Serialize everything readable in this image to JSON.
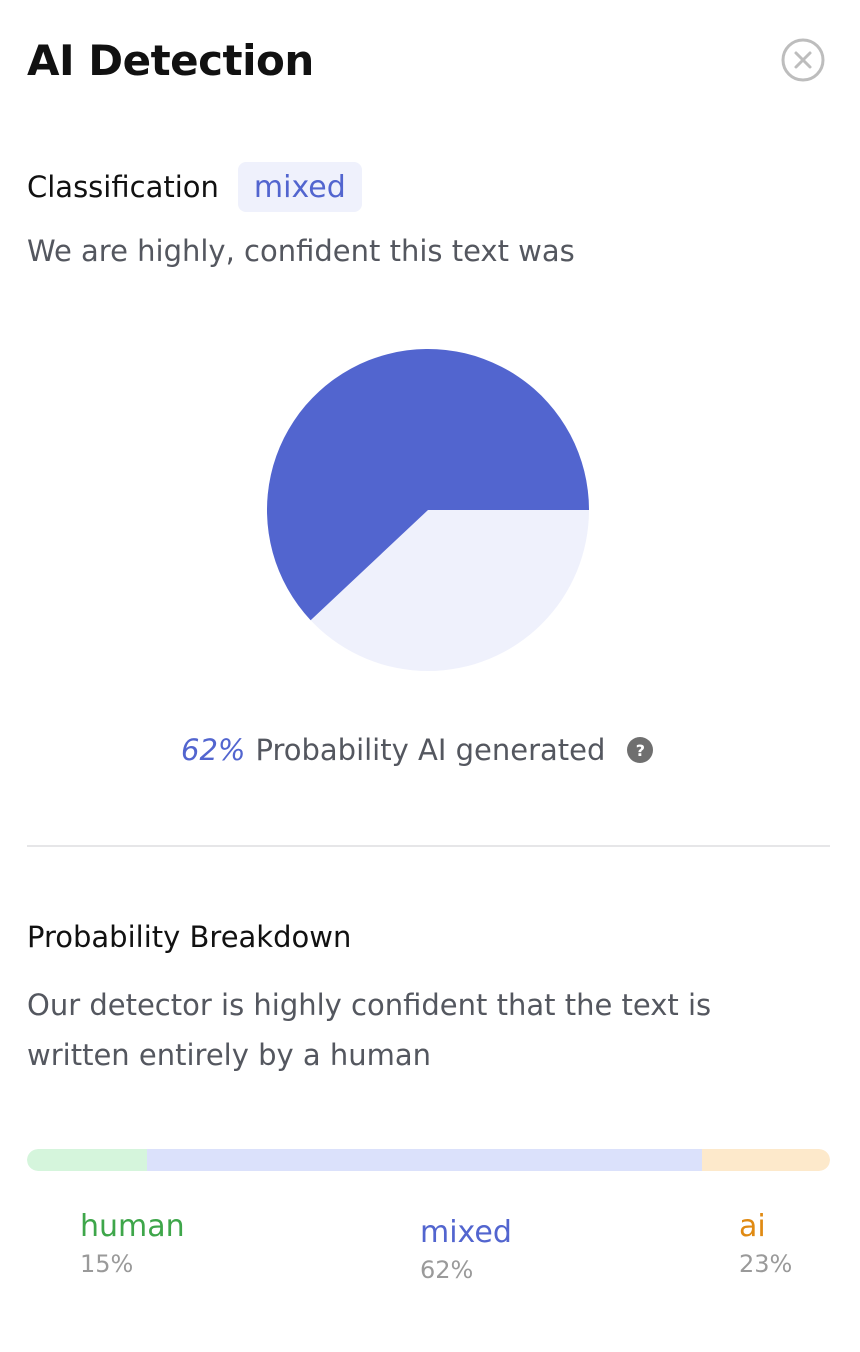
{
  "header": {
    "title": "AI Detection",
    "close_icon": "close-circle-icon"
  },
  "classification": {
    "label": "Classification",
    "badge": "mixed",
    "description": "We are highly, confident this text was"
  },
  "pie": {
    "ai_fraction": 0.62,
    "colors": {
      "filled": "#5265cf",
      "remainder": "#eff1fc"
    }
  },
  "probability": {
    "value": "62%",
    "text": "Probability AI generated",
    "help_icon": "question-circle-icon"
  },
  "breakdown": {
    "title": "Probability Breakdown",
    "description": "Our detector is highly confident that the text is written entirely by a human",
    "items": [
      {
        "name": "human",
        "percent": "15%",
        "color": "#3ea64a"
      },
      {
        "name": "mixed",
        "percent": "62%",
        "color": "#5265cf"
      },
      {
        "name": "ai",
        "percent": "23%",
        "color": "#e08a12"
      }
    ]
  }
}
